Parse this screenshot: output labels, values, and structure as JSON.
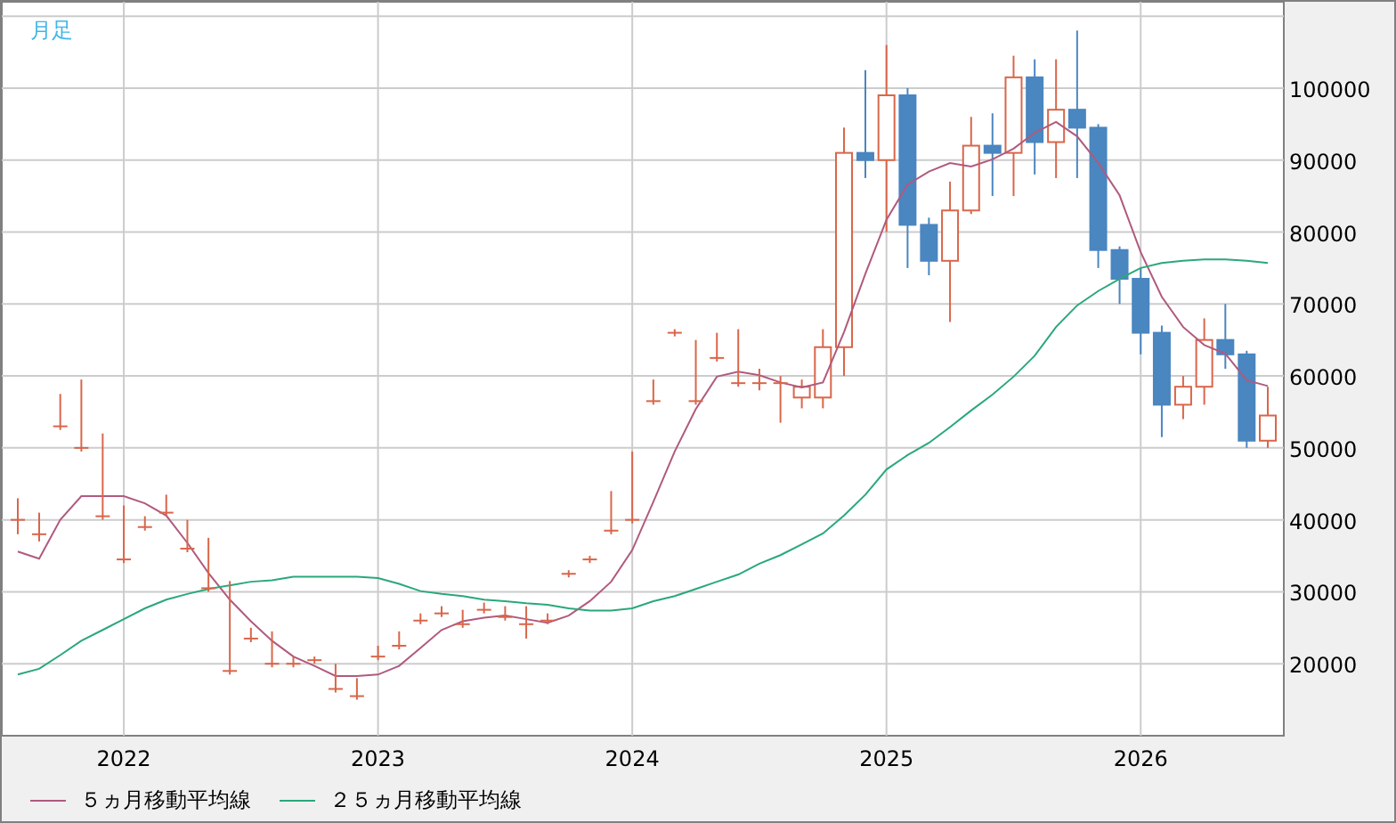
{
  "chart": {
    "period_label": "月足",
    "chart_data": {
      "type": "candlestick",
      "grid": true,
      "xlim": [
        2021.52,
        2026.563
      ],
      "ylim": [
        10000,
        112000
      ],
      "yticks": [
        20000,
        30000,
        40000,
        50000,
        60000,
        70000,
        80000,
        90000,
        100000
      ],
      "xticks": [
        2022,
        2023,
        2024,
        2025,
        2026
      ],
      "x": [
        2021.583,
        2021.667,
        2021.75,
        2021.833,
        2021.917,
        2022,
        2022.083,
        2022.167,
        2022.25,
        2022.333,
        2022.417,
        2022.5,
        2022.583,
        2022.667,
        2022.75,
        2022.833,
        2022.917,
        2023,
        2023.083,
        2023.167,
        2023.25,
        2023.333,
        2023.417,
        2023.5,
        2023.583,
        2023.667,
        2023.75,
        2023.833,
        2023.917,
        2024,
        2024.083,
        2024.167,
        2024.25,
        2024.333,
        2024.417,
        2024.5,
        2024.583,
        2024.667,
        2024.75,
        2024.833,
        2024.917,
        2025,
        2025.083,
        2025.167,
        2025.25,
        2025.333,
        2025.417,
        2025.5,
        2025.583,
        2025.667,
        2025.75,
        2025.833,
        2025.917,
        2026,
        2026.083,
        2026.167,
        2026.25,
        2026.333,
        2026.417,
        2026.5
      ],
      "ohlc": [
        [
          40000,
          43000,
          38000,
          40000
        ],
        [
          38000,
          41000,
          37000,
          38000
        ],
        [
          53000,
          57500,
          52500,
          53000
        ],
        [
          50000,
          59500,
          49500,
          50000
        ],
        [
          40500,
          52000,
          40000,
          40500
        ],
        [
          34500,
          42000,
          34000,
          34500
        ],
        [
          39000,
          40500,
          38500,
          39000
        ],
        [
          41000,
          43500,
          40500,
          41000
        ],
        [
          36000,
          40000,
          35500,
          36000
        ],
        [
          30500,
          37500,
          30000,
          30500
        ],
        [
          19000,
          31500,
          18500,
          19000
        ],
        [
          23500,
          25000,
          23000,
          23500
        ],
        [
          20000,
          24500,
          19500,
          20000
        ],
        [
          20000,
          21000,
          19500,
          20000
        ],
        [
          20500,
          21000,
          20000,
          20500
        ],
        [
          16500,
          20000,
          16000,
          16500
        ],
        [
          15500,
          18000,
          15000,
          15500
        ],
        [
          21000,
          22500,
          20500,
          21000
        ],
        [
          22500,
          24500,
          22000,
          22500
        ],
        [
          26000,
          27000,
          25500,
          26000
        ],
        [
          27000,
          28000,
          26500,
          27000
        ],
        [
          25500,
          27500,
          25000,
          25500
        ],
        [
          27500,
          28500,
          27000,
          27500
        ],
        [
          26500,
          28000,
          26000,
          26500
        ],
        [
          25500,
          28000,
          23500,
          25500
        ],
        [
          26000,
          27000,
          25500,
          26000
        ],
        [
          32500,
          33000,
          32000,
          32500
        ],
        [
          34500,
          35000,
          34000,
          34500
        ],
        [
          38500,
          44000,
          38000,
          38500
        ],
        [
          40000,
          49500,
          39500,
          40000
        ],
        [
          56500,
          59500,
          56000,
          56500
        ],
        [
          66000,
          66500,
          65500,
          66000
        ],
        [
          56500,
          65000,
          56000,
          56500
        ],
        [
          62500,
          66000,
          62000,
          62500
        ],
        [
          59000,
          66500,
          58500,
          59000
        ],
        [
          59000,
          61000,
          58000,
          59000
        ],
        [
          59000,
          60000,
          53500,
          59000
        ],
        [
          57000,
          59500,
          55500,
          58500
        ],
        [
          57000,
          66500,
          55500,
          64000
        ],
        [
          64000,
          94500,
          60000,
          91000
        ],
        [
          91000,
          102500,
          87500,
          90000
        ],
        [
          90000,
          106000,
          80000,
          99000
        ],
        [
          99000,
          100000,
          75000,
          81000
        ],
        [
          81000,
          82000,
          74000,
          76000
        ],
        [
          76000,
          87000,
          67500,
          83000
        ],
        [
          83000,
          96000,
          82500,
          92000
        ],
        [
          92000,
          96500,
          85000,
          91000
        ],
        [
          91000,
          104500,
          85000,
          101500
        ],
        [
          101500,
          104000,
          88000,
          92500
        ],
        [
          92500,
          104000,
          87500,
          97000
        ],
        [
          97000,
          108000,
          87500,
          94500
        ],
        [
          94500,
          95000,
          75000,
          77500
        ],
        [
          77500,
          78000,
          70000,
          73500
        ],
        [
          73500,
          75000,
          63000,
          66000
        ],
        [
          66000,
          67000,
          51500,
          56000
        ],
        [
          56000,
          60000,
          54000,
          58500
        ],
        [
          58500,
          68000,
          56000,
          65000
        ],
        [
          65000,
          70000,
          61000,
          63000
        ],
        [
          63000,
          63500,
          50000,
          51000
        ],
        [
          51000,
          58500,
          50000,
          54500
        ]
      ],
      "series": [
        {
          "name": "５ヵ月移動平均線",
          "type": "line",
          "color": "#b05a7e",
          "values": [
            35600,
            34600,
            40000,
            43300,
            43300,
            43300,
            42300,
            40600,
            36800,
            32600,
            28900,
            25900,
            23200,
            21000,
            19700,
            18300,
            18300,
            18500,
            19700,
            22200,
            24700,
            25900,
            26400,
            26700,
            26200,
            25700,
            26700,
            28700,
            31400,
            35800,
            42500,
            49500,
            55400,
            59900,
            60600,
            60100,
            59100,
            58400,
            59100,
            66100,
            74200,
            81700,
            86600,
            88400,
            89600,
            89100,
            90100,
            91600,
            93800,
            95300,
            93300,
            89600,
            85100,
            77200,
            71000,
            66800,
            64300,
            63100,
            59400,
            58600
          ]
        },
        {
          "name": "２５ヵ月移動平均線",
          "type": "line",
          "color": "#2aa87a",
          "values": [
            18500,
            19300,
            21200,
            23200,
            24700,
            26200,
            27700,
            28900,
            29700,
            30400,
            30900,
            31400,
            31600,
            32100,
            32100,
            32100,
            32100,
            31900,
            31100,
            30100,
            29700,
            29400,
            28900,
            28700,
            28400,
            28200,
            27700,
            27400,
            27400,
            27700,
            28700,
            29400,
            30400,
            31400,
            32400,
            33900,
            35100,
            36600,
            38100,
            40600,
            43500,
            47000,
            49000,
            50700,
            52900,
            55200,
            57400,
            59900,
            62800,
            66800,
            69800,
            71800,
            73500,
            75000,
            75700,
            76000,
            76200,
            76200,
            76000,
            75700
          ]
        }
      ]
    }
  }
}
